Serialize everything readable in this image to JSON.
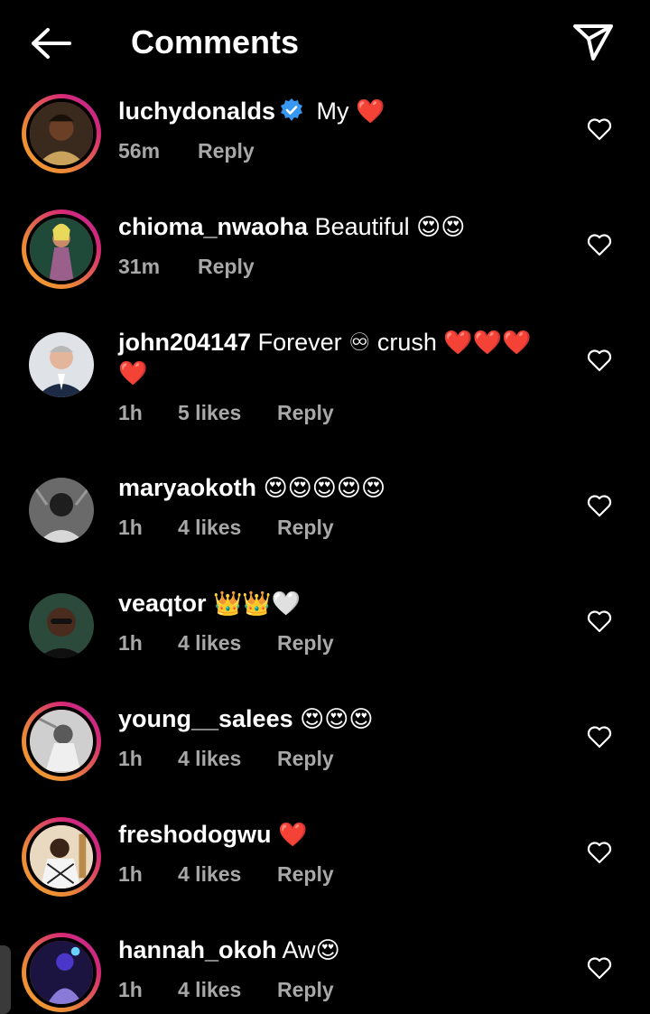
{
  "header": {
    "title": "Comments",
    "back_icon": "arrow-left-icon",
    "share_icon": "paper-plane-icon"
  },
  "comments": [
    {
      "username": "luchydonalds",
      "verified": true,
      "text": "My",
      "emoji": "❤️",
      "time": "56m",
      "likes": "",
      "reply": "Reply",
      "story_ring": true
    },
    {
      "username": "chioma_nwaoha",
      "verified": false,
      "text": "Beautiful",
      "emoji": "😍😍",
      "time": "31m",
      "likes": "",
      "reply": "Reply",
      "story_ring": true
    },
    {
      "username": "john204147",
      "verified": false,
      "text": "Forever ♾ crush",
      "emoji": "❤️❤️❤️❤️",
      "time": "1h",
      "likes": "5 likes",
      "reply": "Reply",
      "story_ring": false
    },
    {
      "username": "maryaokoth",
      "verified": false,
      "text": "",
      "emoji": "😍😍😍😍😍",
      "time": "1h",
      "likes": "4 likes",
      "reply": "Reply",
      "story_ring": false
    },
    {
      "username": "veaqtor",
      "verified": false,
      "text": "",
      "emoji": "👑👑🤍",
      "time": "1h",
      "likes": "4 likes",
      "reply": "Reply",
      "story_ring": false
    },
    {
      "username": "young__salees",
      "verified": false,
      "text": "",
      "emoji": "😍😍😍",
      "time": "1h",
      "likes": "4 likes",
      "reply": "Reply",
      "story_ring": true
    },
    {
      "username": "freshodogwu",
      "verified": false,
      "text": "",
      "emoji": "❤️",
      "time": "1h",
      "likes": "4 likes",
      "reply": "Reply",
      "story_ring": true
    },
    {
      "username": "hannah_okoh",
      "verified": false,
      "text": "Aw",
      "emoji": "😍",
      "time": "1h",
      "likes": "4 likes",
      "reply": "Reply",
      "story_ring": true
    }
  ],
  "colors": {
    "background": "#000000",
    "text": "#ffffff",
    "meta": "#a8a8a8",
    "verified": "#3897f0",
    "heart": "#e8112d"
  }
}
